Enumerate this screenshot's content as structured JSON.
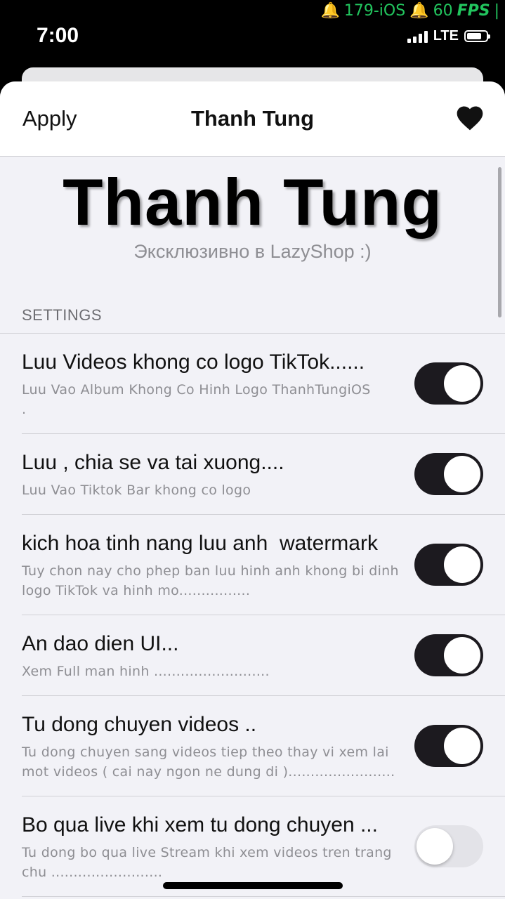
{
  "fps_overlay": {
    "bell_icon": "bell-icon",
    "label": "179-iOS",
    "fps_value": "60",
    "fps_unit": "FPS"
  },
  "status_bar": {
    "time": "7:00",
    "network": "LTE"
  },
  "nav": {
    "apply_label": "Apply",
    "title": "Thanh Tung",
    "heart_icon": "heart-icon"
  },
  "header": {
    "title": "Thanh Tung",
    "subtitle": "Эксклюзивно в LazyShop :)"
  },
  "settings": {
    "section_label": "SETTINGS",
    "rows": [
      {
        "title": "Luu Videos khong co logo TikTok......",
        "subtitle": "Luu Vao Album Khong Co Hinh Logo ThanhTungiOS               .",
        "enabled": true
      },
      {
        "title": "Luu , chia se va tai xuong....",
        "subtitle": "Luu Vao Tiktok Bar khong co logo",
        "enabled": true
      },
      {
        "title": "kich hoa tinh nang luu anh  watermark",
        "subtitle": "Tuy chon nay cho phep ban luu hinh anh khong bi dinh logo TikTok va hinh mo................",
        "enabled": true
      },
      {
        "title": "An dao dien UI...",
        "subtitle": "Xem Full man hinh ..........................",
        "enabled": true
      },
      {
        "title": "Tu dong chuyen videos ..",
        "subtitle": "Tu dong chuyen sang videos tiep theo thay vi xem lai mot videos ( cai nay ngon ne dung di )........................",
        "enabled": true
      },
      {
        "title": "Bo qua live khi xem tu dong chuyen ...",
        "subtitle": "Tu dong bo qua live Stream khi xem videos tren trang chu .........................",
        "enabled": false
      }
    ]
  },
  "colors": {
    "toggle_on": "#1c1a1f",
    "toggle_off": "#e3e3e8",
    "background": "#f2f2f7",
    "fps_green": "#22c55e"
  }
}
